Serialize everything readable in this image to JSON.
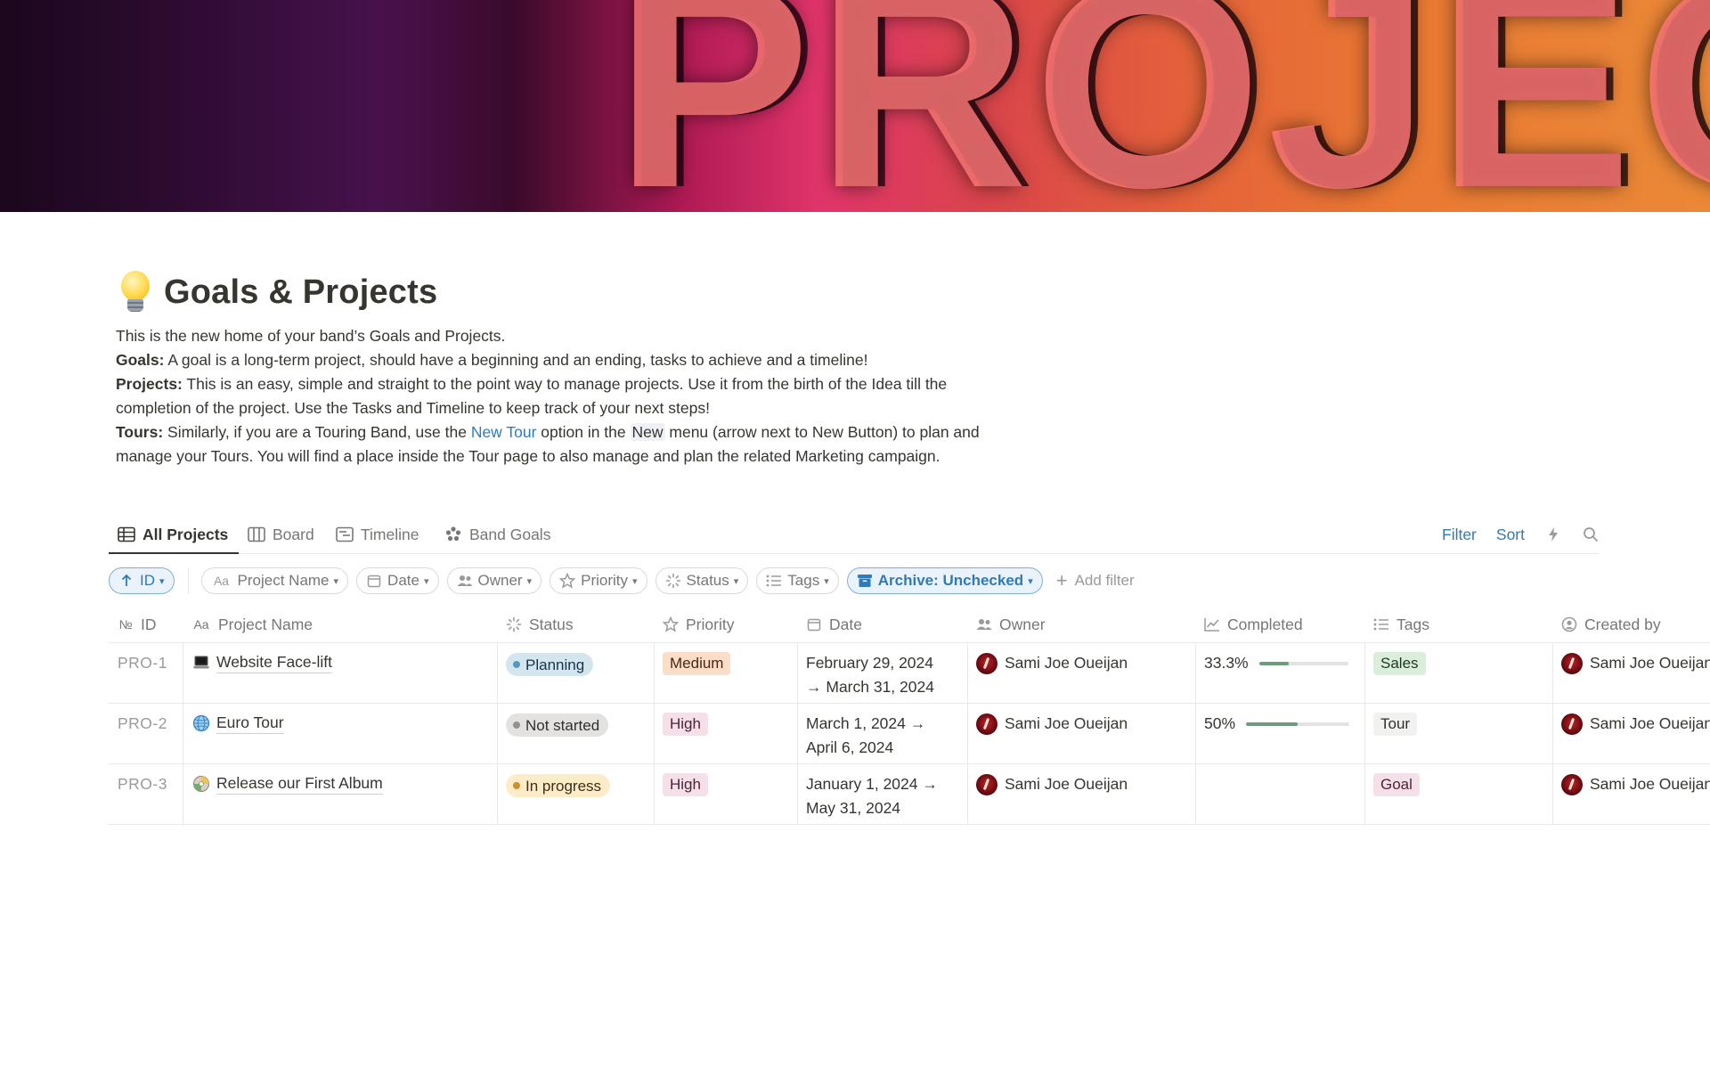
{
  "page": {
    "title": "Goals & Projects",
    "icon": "lightbulb-icon",
    "cover_text": "PROJECTS",
    "intro": "This is the new home of your band’s Goals and Projects.",
    "goals_label": "Goals:",
    "goals_text": " A goal is a long-term project, should have a beginning and an ending, tasks to achieve and a timeline!",
    "projects_label": "Projects:",
    "projects_text": " This is an easy, simple and straight to the point way to manage projects. Use it from the birth of the Idea till the completion of the project. Use the Tasks and Timeline to keep track of your next steps!",
    "tours_label": "Tours:",
    "tours_text_1": " Similarly, if you are a Touring Band, use the ",
    "tours_link": "New Tour",
    "tours_text_2": " option in the ",
    "tours_new": "New",
    "tours_text_3": " menu (arrow next to New Button) to plan and manage your Tours. You will find a place inside the Tour page to also manage and plan the related Marketing campaign."
  },
  "views": {
    "tabs": [
      {
        "label": "All Projects",
        "icon": "table-icon",
        "active": true
      },
      {
        "label": "Board",
        "icon": "board-icon",
        "active": false
      },
      {
        "label": "Timeline",
        "icon": "timeline-icon",
        "active": false
      },
      {
        "label": "Band Goals",
        "icon": "gallery-icon",
        "active": false
      }
    ],
    "filter_label": "Filter",
    "sort_label": "Sort"
  },
  "chips": {
    "sort_chip": "ID",
    "items": [
      "Project Name",
      "Date",
      "Owner",
      "Priority",
      "Status",
      "Tags"
    ],
    "archive_chip": "Archive: Unchecked",
    "add_filter": "Add filter"
  },
  "table": {
    "headers": [
      "ID",
      "Project Name",
      "Status",
      "Priority",
      "Date",
      "Owner",
      "Completed",
      "Tags",
      "Created by"
    ],
    "rows": [
      {
        "id": "PRO-1",
        "name": "Website Face-lift",
        "emoji": "laptop-icon",
        "status": "Planning",
        "priority": "Medium",
        "date_1": "February 29, 2024",
        "date_2": "→ March 31, 2024",
        "owner": "Sami Joe Oueijan",
        "completed_label": "33.3%",
        "completed": 0.333,
        "tag": "Sales",
        "created_by": "Sami Joe Oueijan"
      },
      {
        "id": "PRO-2",
        "name": "Euro Tour",
        "emoji": "globe-icon",
        "status": "Not started",
        "priority": "High",
        "date_1": "March 1, 2024 →",
        "date_2": "April 6, 2024",
        "owner": "Sami Joe Oueijan",
        "completed_label": "50%",
        "completed": 0.5,
        "tag": "Tour",
        "created_by": "Sami Joe Oueijan"
      },
      {
        "id": "PRO-3",
        "name": "Release our First Album",
        "emoji": "disc-icon",
        "status": "In progress",
        "priority": "High",
        "date_1": "January 1, 2024 →",
        "date_2": "May 31, 2024",
        "owner": "Sami Joe Oueijan",
        "completed_label": "",
        "completed": null,
        "tag": "Goal",
        "created_by": "Sami Joe Oueijan"
      }
    ]
  },
  "colors": {
    "accent_blue": "#2f7bb8",
    "planning_bg": "#d3e5ef",
    "planning_dot": "#5b97bd",
    "not_started_bg": "#e3e2e0",
    "not_started_dot": "#91918e",
    "in_progress_bg": "#fdecc8",
    "in_progress_dot": "#cb912f",
    "medium_bg": "#fadec9",
    "high_bg": "#f5e0e9",
    "sales_bg": "#dbeddb",
    "tour_bg": "#f1f1ef",
    "goal_bg": "#f5e0e9",
    "progress_fill": "#6c9b7d"
  }
}
